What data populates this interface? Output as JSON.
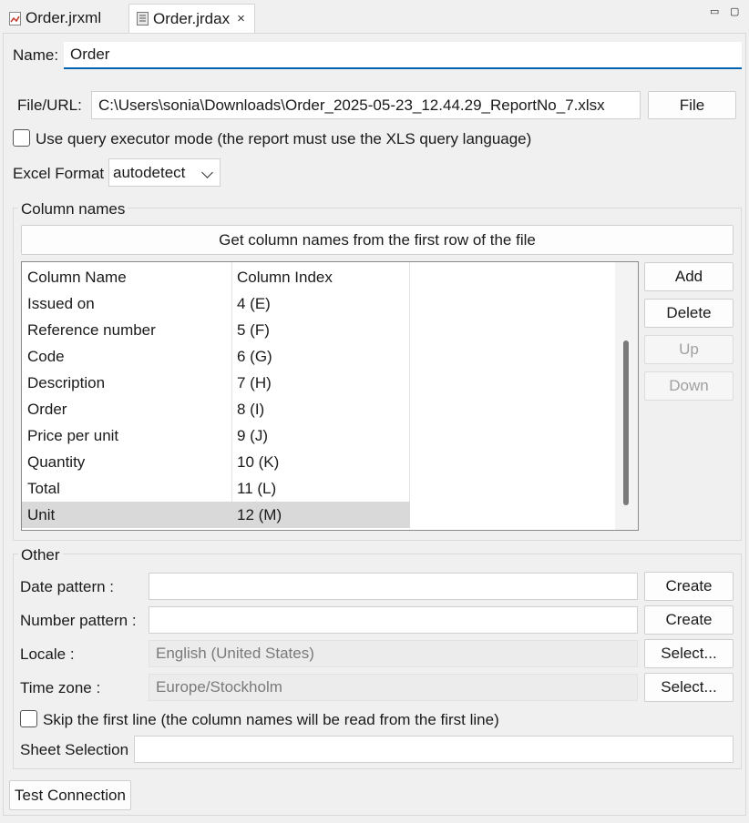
{
  "tabs": [
    {
      "label": "Order.jrxml",
      "icon": "jrxml-file-icon"
    },
    {
      "label": "Order.jrdax",
      "icon": "jrdax-file-icon",
      "close": "×"
    }
  ],
  "window_controls": {
    "minimize": "▭",
    "maximize": "▢"
  },
  "name": {
    "label": "Name:",
    "value": "Order"
  },
  "file_url": {
    "label": "File/URL:",
    "value": "C:\\Users\\sonia\\Downloads\\Order_2025-05-23_12.44.29_ReportNo_7.xlsx",
    "button": "File"
  },
  "query_executor": {
    "label": "Use query executor mode (the report must use the XLS query language)",
    "checked": false
  },
  "excel_format": {
    "label": "Excel Format",
    "value": "autodetect"
  },
  "column_names": {
    "group_title": "Column names",
    "get_button": "Get column names from the first row of the file",
    "headers": [
      "Column Name",
      "Column Index"
    ],
    "rows": [
      [
        "Issued on",
        "4 (E)"
      ],
      [
        "Reference number",
        "5 (F)"
      ],
      [
        "Code",
        "6 (G)"
      ],
      [
        "Description",
        "7 (H)"
      ],
      [
        "Order",
        "8 (I)"
      ],
      [
        "Price per unit",
        "9 (J)"
      ],
      [
        "Quantity",
        "10 (K)"
      ],
      [
        "Total",
        "11 (L)"
      ],
      [
        "Unit",
        "12 (M)"
      ]
    ],
    "selected_row": 8,
    "buttons": {
      "add": "Add",
      "delete": "Delete",
      "up": "Up",
      "down": "Down"
    }
  },
  "other": {
    "group_title": "Other",
    "date_pattern": {
      "label": "Date pattern :",
      "value": "",
      "button": "Create"
    },
    "number_pattern": {
      "label": "Number pattern :",
      "value": "",
      "button": "Create"
    },
    "locale": {
      "label": "Locale :",
      "value": "English (United States)",
      "button": "Select..."
    },
    "time_zone": {
      "label": "Time zone :",
      "value": "Europe/Stockholm",
      "button": "Select..."
    },
    "skip_first_line": {
      "label": "Skip the first line (the column names will be read from the first line)",
      "checked": false
    },
    "sheet_selection": {
      "label": "Sheet Selection",
      "value": ""
    }
  },
  "test_connection": "Test Connection",
  "colors": {
    "accent_underline": "#0063b1",
    "selected_row": "#d9d9d9"
  }
}
